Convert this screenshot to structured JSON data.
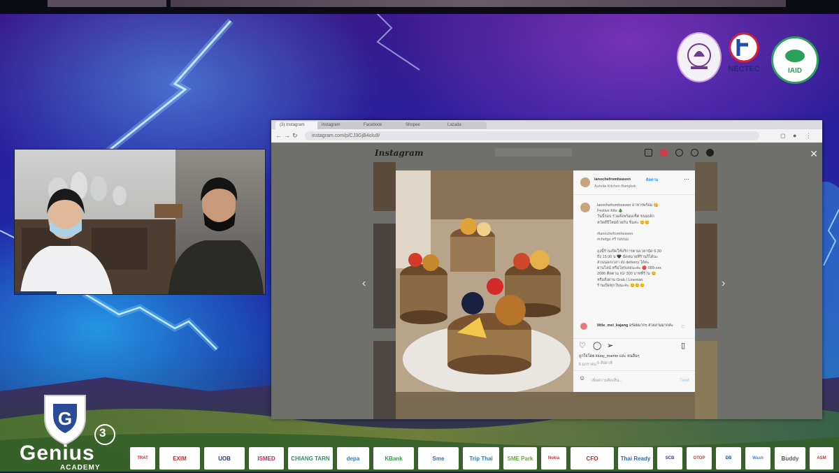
{
  "colors": {
    "bg_top": "#3b1a8a",
    "bg_bottom": "#1a3aa8",
    "instagram_blue": "#3897f0",
    "genius_text": "#ffffff"
  },
  "browser": {
    "tabs": [
      "(3) Instagram",
      "Instagram",
      "Facebook",
      "Shopee",
      "Lazada"
    ],
    "address": "instagram.com/p/CJ3GjB4oIu9/",
    "close_icon": "close-icon"
  },
  "instagram": {
    "logo": "Instagram",
    "post": {
      "username": "lanochefromheaven",
      "follow": "ติดตาม",
      "location": "Aurelia Kitchen Bangkok",
      "caption_user": "lanochefromheaven",
      "caption_lines": [
        "lanochefromheaven อาหารพร้อม 😋",
        "Festive Kits 🎄",
        "วันนี้รอบ ร่วมสั่งพร้อมเซ็ต ขนมเค้ก",
        "หวัดดีปีใหม่ด้วยกัน ขิ่มค่ะ 😊😊",
        "",
        "#lanochefromheaven",
        "#chefgo #ร้านขนม",
        "",
        "ถุงนี้ร้านเปิดให้บริการตามเวลานัด 9.30",
        "ถึง 15.00 น 🖤 นัดหมายที่ร้านก็ได้นะ",
        "ส่วนนอกเวลา ส่ง delivery ได้ค่ะ",
        "ผ่านไลน์ หรือโทรเลยนะคะ 🔴 089-xxx",
        "2086 ติดตาม IG/ 300 บาทที่ร้าน 😊",
        "หรือสั่งผ่าน Grab / Lineman",
        "ร้านเปิดทุกวันนะคะ 😊😊😊"
      ],
      "caption_time": "6 สัปดาห์",
      "comment_user": "little_mei_kajang",
      "comment_text": "อร่อยมากๆ สวยงามมากค่ะ",
      "likes": "ถูกใจโดย  kluay_mamin และ คนอื่นๆ",
      "date": "5 มกราคม",
      "comment_placeholder": "เพิ่มความคิดเห็น...",
      "post_button": "โพสต์"
    }
  },
  "event": {
    "brand": "Genius",
    "brand_number": "3",
    "brand_sub": "ACADEMY"
  },
  "logos_top": [
    "university-seal-logo",
    "nesdc-logo",
    "iaid-logo"
  ],
  "sponsors": [
    "TRAT",
    "EXIM",
    "UOB",
    "ISMED",
    "CHIANG TARN",
    "depa",
    "KBank",
    "Sme",
    "Trip Thai",
    "SME Park",
    "Nokia",
    "CFO",
    "Thai Ready",
    "SCB",
    "OTOP",
    "DB",
    "Wash",
    "Buddy",
    "ASM"
  ],
  "labels": {
    "iaid": "IAID",
    "nesdc": "NECTEC"
  }
}
